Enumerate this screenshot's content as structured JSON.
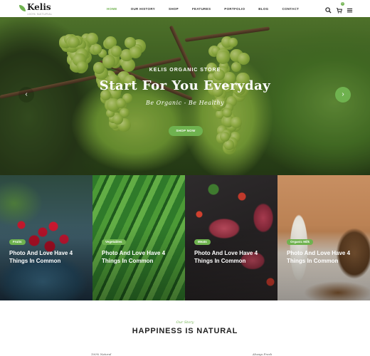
{
  "header": {
    "logo_text": "Kelis",
    "logo_tagline": "100% NATURAL",
    "nav": [
      "HOME",
      "OUR HISTORY",
      "SHOP",
      "FEATURES",
      "PORTFOLIO",
      "BLOG",
      "CONTACT"
    ],
    "active_nav": "HOME",
    "icons": [
      "search-icon",
      "cart-icon",
      "menu-icon"
    ],
    "cart_count": "0"
  },
  "hero": {
    "subtitle": "KELIS ORGANIC STORE",
    "title": "Start For You Everyday",
    "tagline": "Be Organic - Be Healthy",
    "button": "SHOP NOW",
    "prev_icon": "‹",
    "next_icon": "›"
  },
  "cards": [
    {
      "badge": "Fruits",
      "title": "Photo And Love Have 4 Things In Common"
    },
    {
      "badge": "Vegetables",
      "title": "Photo And Love Have 4 Things In Common"
    },
    {
      "badge": "Meats",
      "title": "Photo And Love Have 4 Things In Common"
    },
    {
      "badge": "Organic Milk",
      "title": "Photo And Love Have 4 Things In Common"
    }
  ],
  "story": {
    "subtitle": "Our Story",
    "title": "HAPPINESS IS NATURAL"
  },
  "features": [
    "100% Natural",
    "Always Fresh"
  ],
  "colors": {
    "accent": "#6fb24f"
  }
}
